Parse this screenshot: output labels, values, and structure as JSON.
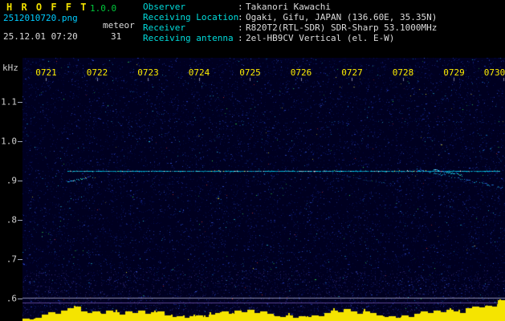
{
  "header": {
    "app_name": "H R O F F T",
    "version": "1.0.0",
    "filename": "2512010720.png",
    "mode": "meteor",
    "datetime": "25.12.01 07:20",
    "count": "31",
    "separator": ":",
    "info": [
      {
        "label": "Observer",
        "value": "Takanori Kawachi"
      },
      {
        "label": "Receiving Location",
        "value": "Ogaki, Gifu, JAPAN (136.60E, 35.35N)"
      },
      {
        "label": "Receiver",
        "value": "R820T2(RTL-SDR) SDR-Sharp 53.1000MHz"
      },
      {
        "label": "Receiving antenna",
        "value": "2el-HB9CV Vertical (el. E-W)"
      }
    ]
  },
  "chart_data": {
    "type": "heatmap",
    "ylabel": "kHz",
    "x_ticks": [
      "0721",
      "0722",
      "0723",
      "0724",
      "0725",
      "0726",
      "0727",
      "0728",
      "0729",
      "0730"
    ],
    "y_ticks": [
      {
        "label": "1.1",
        "khz": 1.1
      },
      {
        "label": "1.0",
        "khz": 1.0
      },
      {
        "label": ".9",
        "khz": 0.9
      },
      {
        "label": ".8",
        "khz": 0.8
      },
      {
        "label": ".7",
        "khz": 0.7
      },
      {
        "label": ".6",
        "khz": 0.6
      }
    ],
    "y_range_khz": [
      0.56,
      1.19
    ],
    "colors": {
      "background": "#000020",
      "carrier": "#00dcff",
      "bars": "#f5e400",
      "time_tick_label": "#ffee00",
      "axis_label": "#cfcfcf"
    },
    "carrier": {
      "khz": 0.923,
      "t_start": 721.43,
      "t_end": 729.9
    },
    "meteor_trails": [
      {
        "t0": 721.43,
        "f0": 0.897,
        "t1": 721.78,
        "f1": 0.906,
        "intensity": "bright"
      },
      {
        "t0": 726.55,
        "f0": 0.92,
        "t1": 727.97,
        "f1": 0.884,
        "intensity": "faint"
      },
      {
        "t0": 728.28,
        "f0": 0.928,
        "t1": 729.94,
        "f1": 0.882,
        "intensity": "medium"
      },
      {
        "t0": 728.6,
        "f0": 0.927,
        "t1": 729.15,
        "f1": 0.914,
        "intensity": "bright"
      },
      {
        "t0": 729.3,
        "f0": 1.05,
        "t1": 729.95,
        "f1": 0.945,
        "intensity": "vfaint"
      },
      {
        "t0": 722.2,
        "f0": 1.049,
        "t1": 729.8,
        "f1": 1.049,
        "intensity": "sparse"
      },
      {
        "t0": 723.55,
        "f0": 1.165,
        "t1": 723.9,
        "f1": 1.14,
        "intensity": "vfaint"
      },
      {
        "t0": 727.95,
        "f0": 1.17,
        "t1": 728.4,
        "f1": 1.148,
        "intensity": "vfaint"
      }
    ],
    "interference_lines": [
      {
        "khz": 0.602,
        "color": "#b8b8d8"
      },
      {
        "khz": 0.589,
        "color": "#7a5ab8"
      }
    ],
    "activity_bars": [
      3,
      2,
      4,
      8,
      11,
      9,
      13,
      16,
      18,
      12,
      10,
      12,
      9,
      13,
      11,
      8,
      12,
      10,
      13,
      9,
      11,
      12,
      7,
      5,
      6,
      4,
      6,
      7,
      5,
      8,
      10,
      12,
      9,
      13,
      11,
      14,
      10,
      12,
      9,
      6,
      5,
      7,
      4,
      6,
      5,
      7,
      6,
      10,
      13,
      11,
      15,
      12,
      9,
      12,
      10,
      7,
      5,
      6,
      4,
      7,
      5,
      9,
      12,
      10,
      13,
      11,
      14,
      12,
      10,
      16,
      18,
      17,
      19,
      18,
      26
    ],
    "noise_density": 15000
  }
}
